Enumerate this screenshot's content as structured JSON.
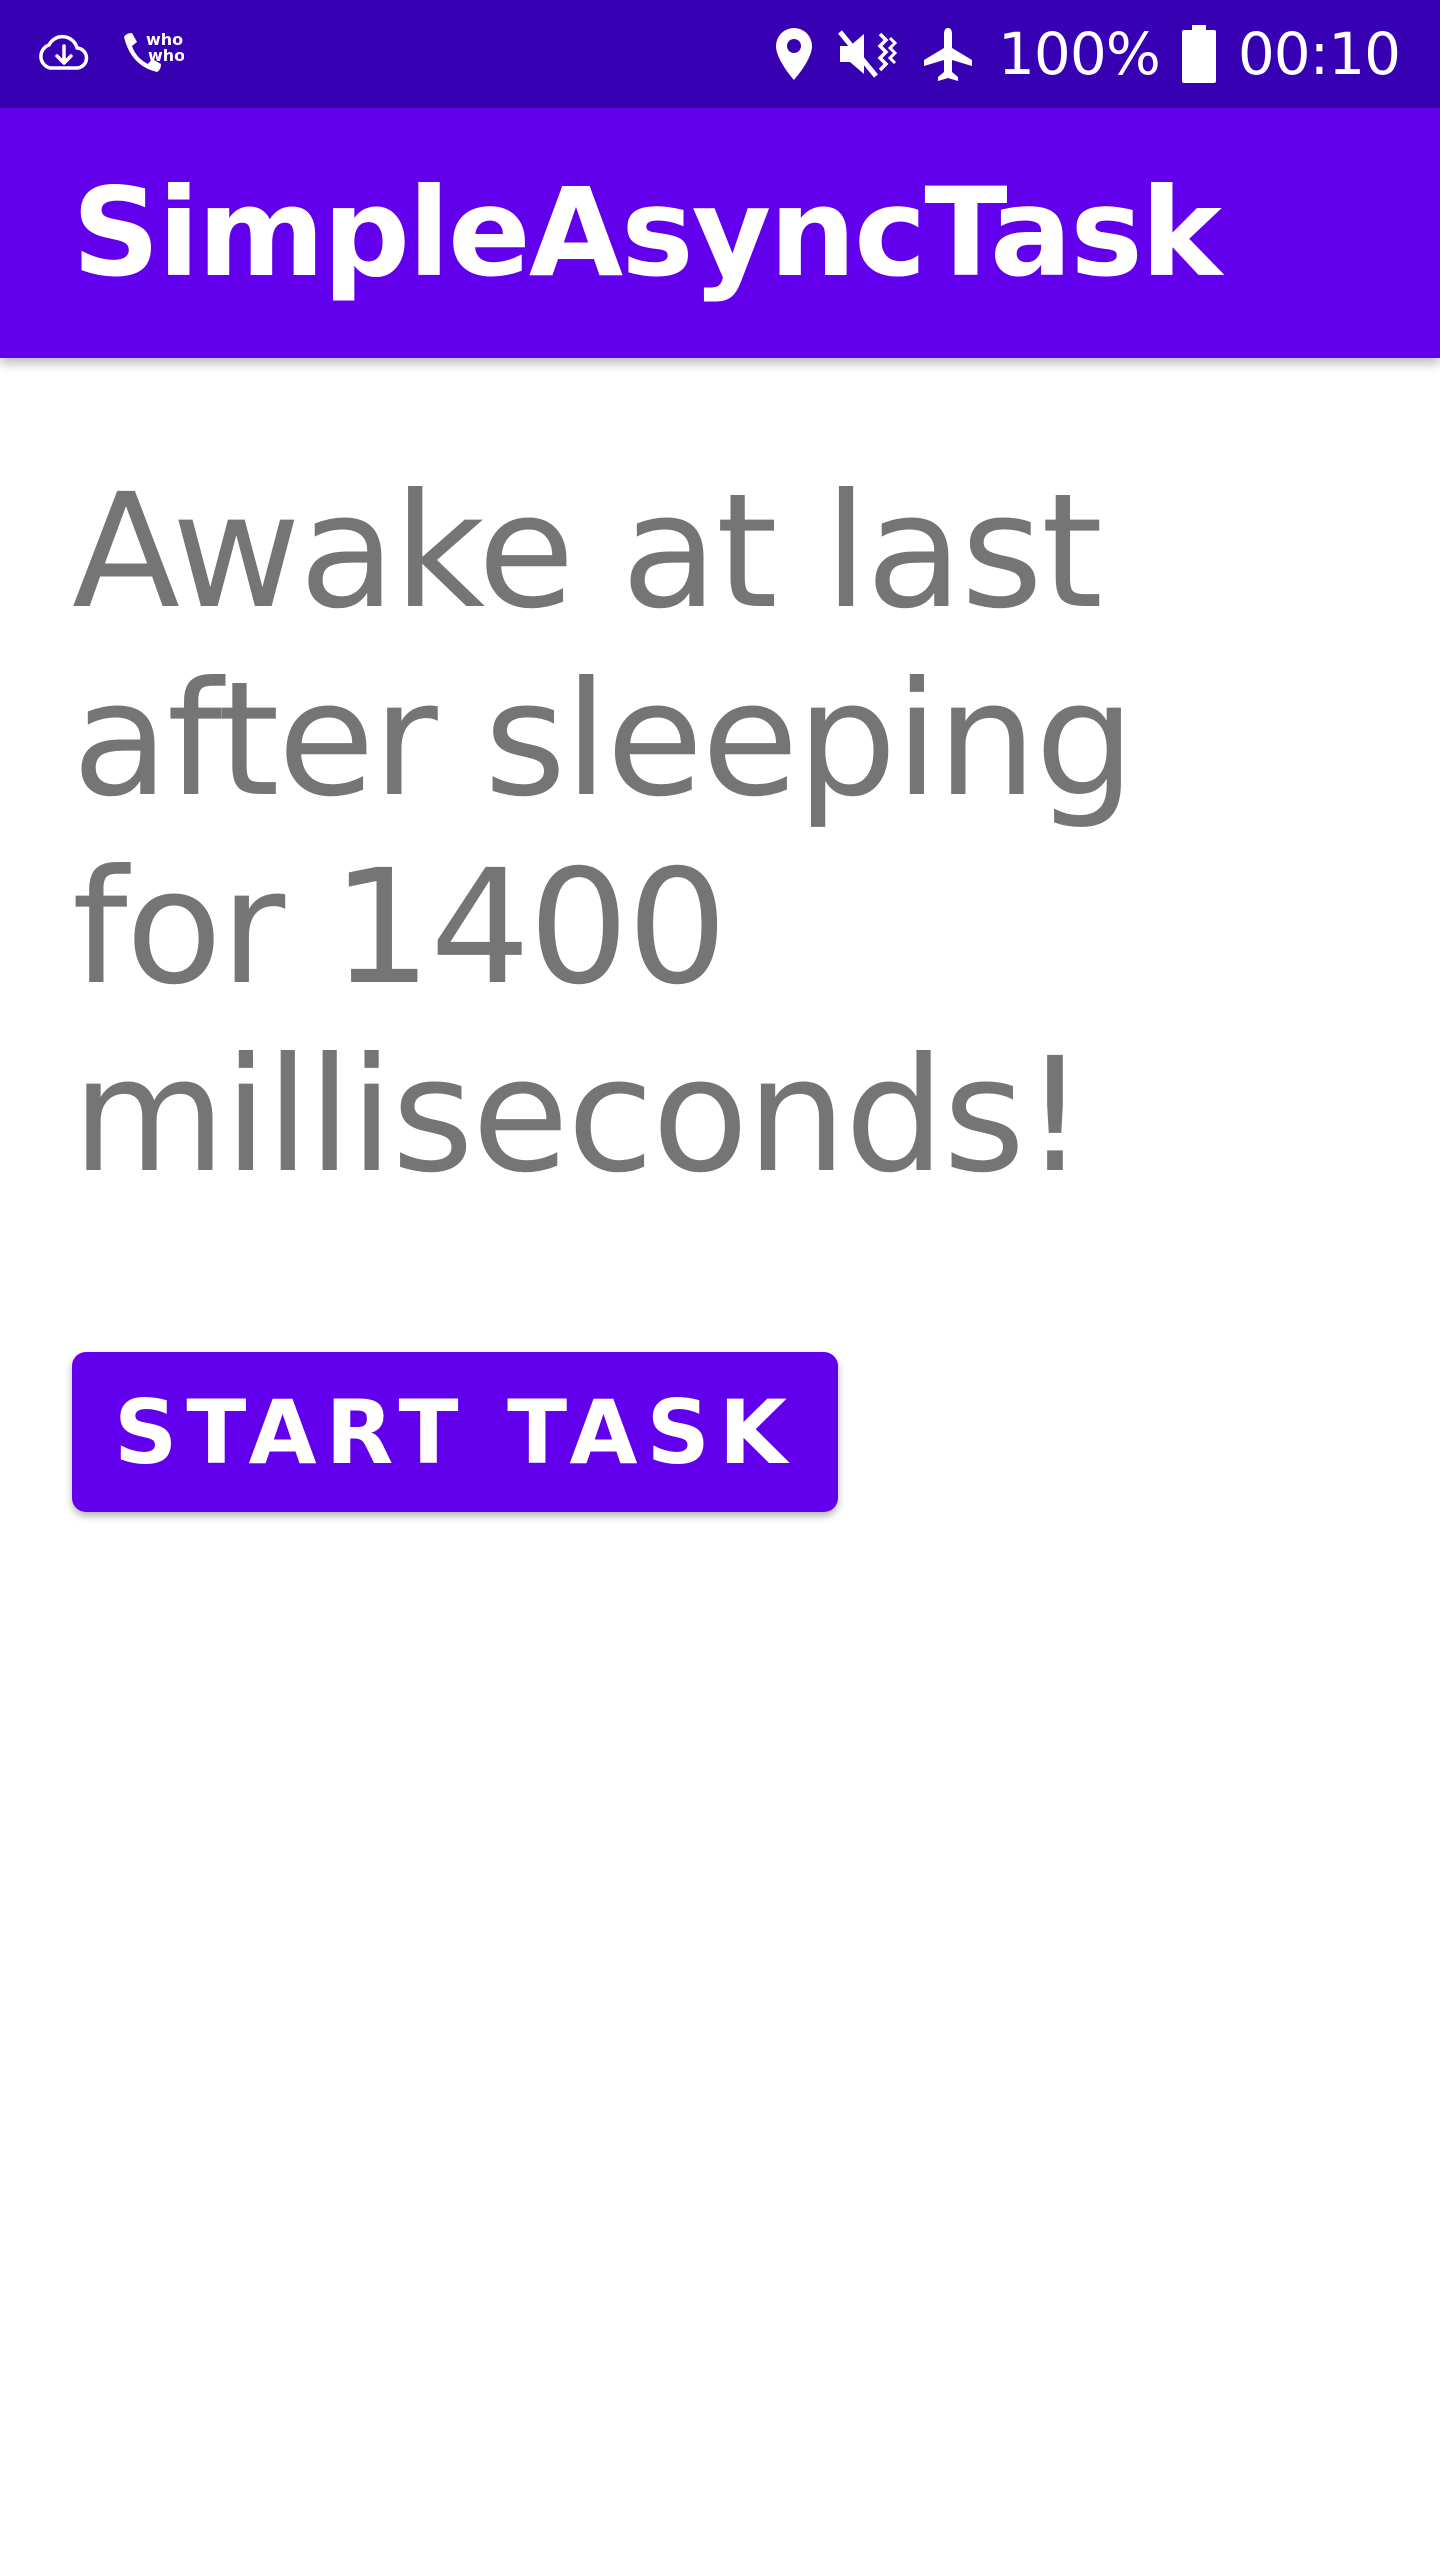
{
  "status_bar": {
    "battery_percent": "100%",
    "time": "00:10",
    "left_icons": [
      "cloud-download-icon",
      "whoscall-phone-icon"
    ],
    "right_icons": [
      "location-icon",
      "vibrate-mute-icon",
      "airplane-mode-icon",
      "battery-icon"
    ],
    "background_color": "#3700b3"
  },
  "app_bar": {
    "title": "SimpleAsyncTask",
    "background_color": "#6200ee"
  },
  "main": {
    "result_text": "Awake at last after sleeping for 1400 milliseconds!",
    "start_button_label": "START TASK",
    "text_color": "#757575",
    "button_color": "#6200ee"
  }
}
